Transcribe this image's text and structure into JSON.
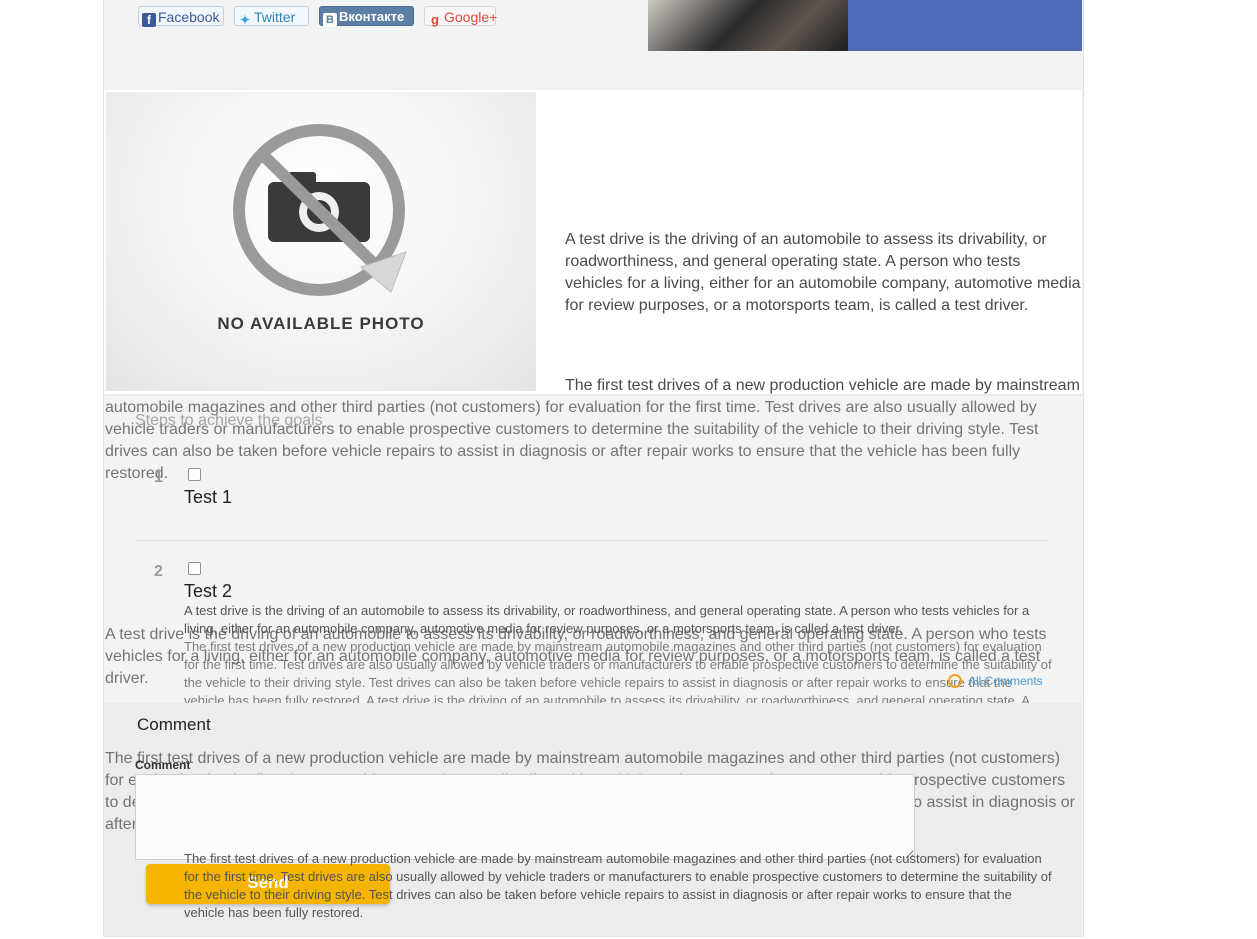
{
  "social": {
    "facebook": "Facebook",
    "twitter": "Twitter",
    "vkontakte": "Вконтакте",
    "google": "Google+"
  },
  "no_photo": {
    "label": "NO AVAILABLE PHOTO"
  },
  "article": {
    "p1": "A test drive is the driving of an automobile to assess its drivability, or roadworthiness, and general operating state. A person who tests vehicles for a living, either for an automobile company, automotive media for review purposes, or a motorsports team, is called a test driver.",
    "p2_line1": "The first test drives of a new production vehicle are made by mainstream",
    "p2_rest": "automobile magazines and other third parties (not customers) for evaluation for the first time. Test drives are also usually allowed by vehicle traders or manufacturers to enable prospective customers to determine the suitability of the vehicle to their driving style. Test drives can also be taken before vehicle repairs to assist in diagnosis or after repair works to ensure that the vehicle has been fully restored."
  },
  "steps": {
    "title": "Steps to achieve the goals",
    "items": [
      {
        "num": "1",
        "title": "Test 1"
      },
      {
        "num": "2",
        "title": "Test 2",
        "p1": "A test drive is the driving of an automobile to assess its drivability, or roadworthiness, and general operating state. A person who tests vehicles for a living, either for an automobile company, automotive media for review purposes, or a motorsports team, is called a test driver.",
        "p2": "The first test drives of a new production vehicle are made by mainstream automobile magazines and other third parties (not customers) for evaluation for the first time. Test drives are also usually allowed by vehicle traders or manufacturers to enable prospective customers to determine the suitability of the vehicle to their driving style. Test drives can also be taken before vehicle repairs to assist in diagnosis or after repair works to ensure that the vehicle has been fully restored. A test drive is the driving of an automobile to assess its drivability, or roadworthiness, and general operating state. A person who tests vehicles for a living, either for an automobile company, automotive media for review purposes, or a motorsports team, is called a test driver. The first test drives of a new production vehicle are made by mainstream automobile magazines and other third parties (not customers) for evaluation for the first time. Test drives are also usually allowed by vehicle traders or manufacturers to enable prospective customers to determine the suitability of the vehicle to their driving style. Test drives can also be taken before vehicle repairs to assist in diagnosis or after repair works to ensure that the vehicle has been fully restored.",
        "p3": "The first test drives of a new production vehicle are made by mainstream automobile magazines and other third parties (not customers) for evaluation for the first time. Test drives are also usually allowed by vehicle traders or manufacturers to enable prospective customers to determine the suitability of the vehicle to their driving style. Test drives can also be taken before vehicle repairs to assist in diagnosis or after repair works to ensure that the vehicle has been fully restored."
      }
    ]
  },
  "repeat_text": {
    "p1": "A test drive is the driving of an automobile to assess its drivability, or roadworthiness, and general operating state. A person who tests vehicles for a living, either for an automobile company, automotive media for review purposes, or a motorsports team, is called a test driver.",
    "p2": "The first test drives of a new production vehicle are made by mainstream automobile magazines and other third parties (not customers) for evaluation for the first time. Test drives are also usually allowed by vehicle traders or manufacturers to enable prospective customers to determine the suitability of the vehicle to their driving style. Test drives can also be taken before vehicle repairs to assist in diagnosis or after repair works to ensure that the vehicle has been fully restored."
  },
  "comments_link": "All Comments",
  "comment_form": {
    "heading": "Comment",
    "label": "Comment",
    "value": "",
    "send": "Send"
  }
}
